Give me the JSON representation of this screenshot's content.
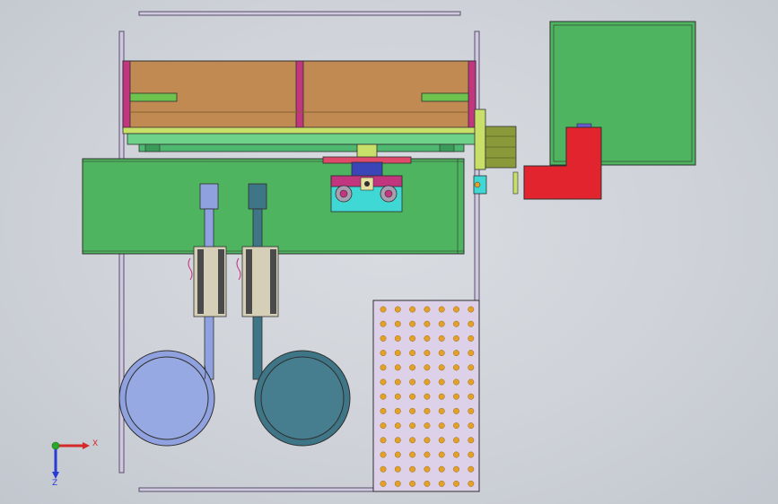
{
  "window": {
    "type": "cad-3d-viewport",
    "view": "top",
    "background_colors": [
      "#d9dde2",
      "#c2c7ce"
    ]
  },
  "triad": {
    "x_label": "X",
    "z_label": "Z",
    "x_color": "#d42a2a",
    "y_color": "#2aa82a",
    "z_color": "#2a3ad4"
  },
  "model": {
    "parts": [
      "frame-rail",
      "conveyor-tray",
      "long-green-plate",
      "carriage-block",
      "winding-coil-light",
      "winding-coil-dark",
      "perforated-plate",
      "control-cabinet",
      "red-motor-bracket",
      "drive-motor"
    ],
    "colors": {
      "tray": "#c08a52",
      "plate_green": "#4fb45f",
      "frame": "#c9c3db",
      "coil_light": "#8fa2df",
      "coil_dark": "#3f7687",
      "perforated": "#dcd1e8",
      "hole": "#e3a12a",
      "red_bracket": "#e2242e",
      "cyan_block": "#3fd8d4",
      "magenta": "#c2357f"
    }
  }
}
